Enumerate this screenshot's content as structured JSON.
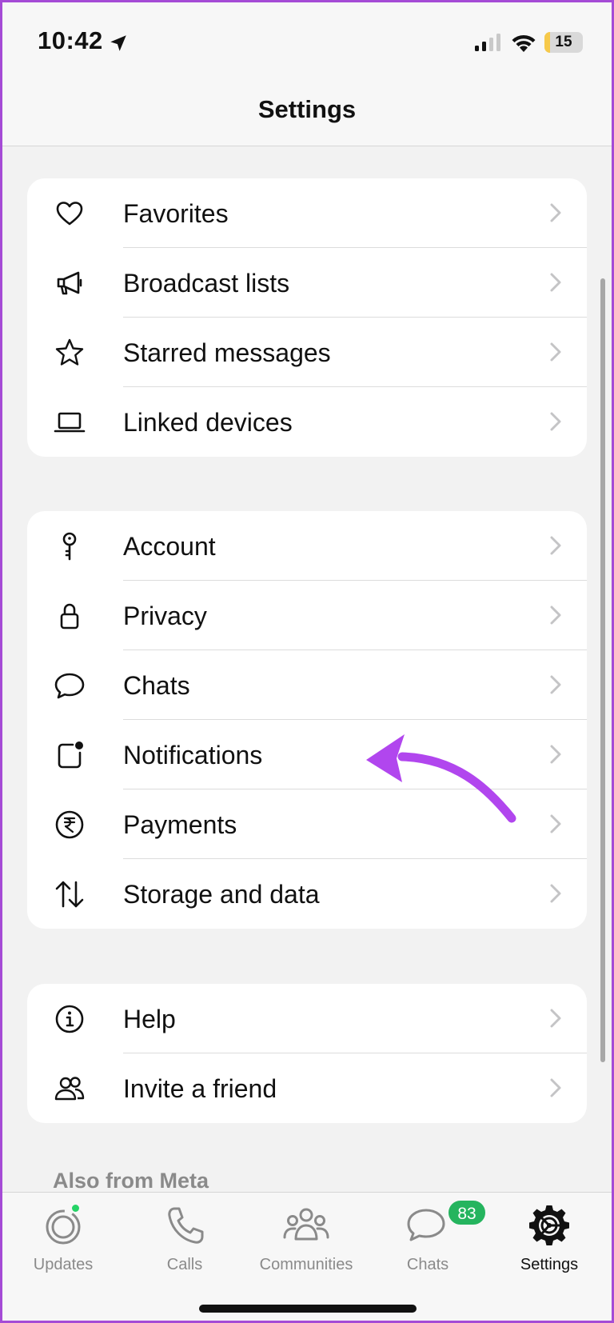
{
  "status_bar": {
    "time": "10:42",
    "battery_level": "15",
    "battery_fraction": 0.15,
    "icons": [
      "location-arrow-icon",
      "cellular-signal-icon",
      "wifi-icon",
      "battery-icon"
    ]
  },
  "header": {
    "title": "Settings"
  },
  "groups": [
    {
      "items": [
        {
          "label": "Favorites",
          "icon": "heart-icon"
        },
        {
          "label": "Broadcast lists",
          "icon": "megaphone-icon"
        },
        {
          "label": "Starred messages",
          "icon": "star-icon"
        },
        {
          "label": "Linked devices",
          "icon": "laptop-icon"
        }
      ]
    },
    {
      "items": [
        {
          "label": "Account",
          "icon": "key-icon"
        },
        {
          "label": "Privacy",
          "icon": "lock-icon"
        },
        {
          "label": "Chats",
          "icon": "speech-bubble-icon"
        },
        {
          "label": "Notifications",
          "icon": "notification-badge-icon"
        },
        {
          "label": "Payments",
          "icon": "rupee-icon"
        },
        {
          "label": "Storage and data",
          "icon": "up-down-arrows-icon"
        }
      ]
    },
    {
      "items": [
        {
          "label": "Help",
          "icon": "info-icon"
        },
        {
          "label": "Invite a friend",
          "icon": "people-icon"
        }
      ]
    }
  ],
  "section": {
    "also_from_meta": "Also from Meta"
  },
  "tab_bar": {
    "tabs": [
      {
        "label": "Updates",
        "icon": "updates-icon",
        "active": false,
        "has_dot": true
      },
      {
        "label": "Calls",
        "icon": "phone-icon",
        "active": false
      },
      {
        "label": "Communities",
        "icon": "communities-icon",
        "active": false
      },
      {
        "label": "Chats",
        "icon": "chats-icon",
        "active": false,
        "badge": "83"
      },
      {
        "label": "Settings",
        "icon": "settings-gear-icon",
        "active": true
      }
    ]
  },
  "colors": {
    "annotation_arrow": "#b146ee",
    "badge_green": "#25b45e",
    "battery_yellow": "#f6c94a",
    "frame_border": "#a54bd6"
  }
}
